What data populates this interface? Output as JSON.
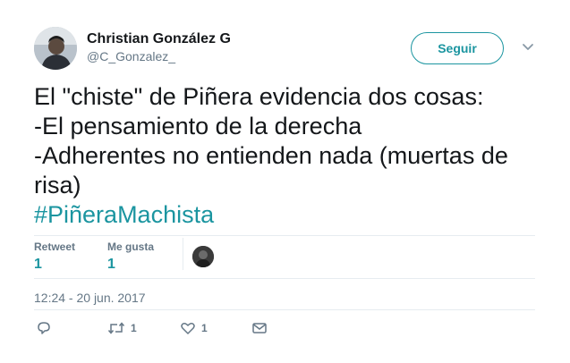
{
  "author": {
    "name": "Christian González G",
    "handle": "@C_Gonzalez_"
  },
  "follow_button": {
    "label": "Seguir"
  },
  "tweet": {
    "lines": [
      "El \"chiste\" de Piñera evidencia dos cosas:",
      "-El pensamiento de la derecha",
      "-Adherentes no entienden nada (muertas de",
      "risa)"
    ],
    "hashtag": "#PiñeraMachista"
  },
  "stats": {
    "retweets": {
      "label": "Retweet",
      "value": "1"
    },
    "likes": {
      "label": "Me gusta",
      "value": "1"
    }
  },
  "timestamp": "12:24 - 20 jun. 2017",
  "actions": {
    "reply": {
      "icon": "reply-icon",
      "count": ""
    },
    "retweet": {
      "icon": "retweet-icon",
      "count": "1"
    },
    "like": {
      "icon": "heart-icon",
      "count": "1"
    },
    "message": {
      "icon": "envelope-icon",
      "count": ""
    }
  },
  "colors": {
    "accent": "#1b95a0",
    "text": "#14171a",
    "muted": "#657786",
    "divider": "#e6ecf0"
  }
}
